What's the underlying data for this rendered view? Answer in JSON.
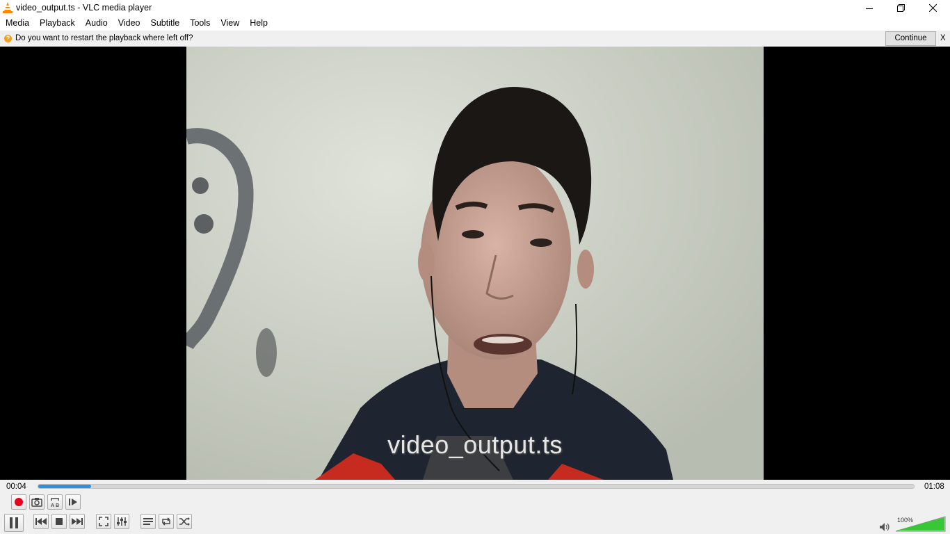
{
  "window": {
    "title": "video_output.ts - VLC media player",
    "app_icon": "vlc-cone-icon"
  },
  "menu": [
    "Media",
    "Playback",
    "Audio",
    "Video",
    "Subtitle",
    "Tools",
    "View",
    "Help"
  ],
  "notification": {
    "icon": "question-icon",
    "message": "Do you want to restart the playback where left off?",
    "continue_label": "Continue",
    "close_label": "X"
  },
  "video": {
    "osd_title": "video_output.ts"
  },
  "playback": {
    "elapsed": "00:04",
    "total": "01:08",
    "progress_fraction": 0.06
  },
  "volume": {
    "label": "100%",
    "level_fraction": 1.0
  },
  "colors": {
    "accent": "#2f8fd9",
    "record": "#e8001c",
    "volume_green": "#37c737"
  }
}
